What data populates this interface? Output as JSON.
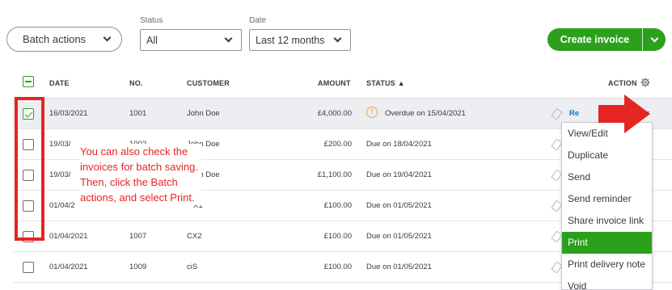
{
  "toolbar": {
    "batch_actions": "Batch actions",
    "status_label": "Status",
    "status_value": "All",
    "date_label": "Date",
    "date_value": "Last 12 months",
    "create_invoice": "Create invoice"
  },
  "table": {
    "headers": {
      "date": "DATE",
      "no": "NO.",
      "customer": "CUSTOMER",
      "amount": "AMOUNT",
      "status": "STATUS ▲",
      "action": "ACTION"
    },
    "rows": [
      {
        "date": "16/03/2021",
        "no": "1001",
        "customer": "John Doe",
        "amount": "£4,000.00",
        "status": "Overdue on 15/04/2021",
        "checked": true,
        "action": "Re"
      },
      {
        "date": "19/03/",
        "no": "1002",
        "customer": "John Doe",
        "amount": "£200.00",
        "status": "Due on 18/04/2021",
        "checked": false
      },
      {
        "date": "19/03/",
        "no": "",
        "customer": "John Doe",
        "amount": "£1,100.00",
        "status": "Due on 19/04/2021",
        "checked": false
      },
      {
        "date": "01/04/2",
        "no": "",
        "customer": "X1",
        "amount": "£100.00",
        "status": "Due on 01/05/2021",
        "checked": false
      },
      {
        "date": "01/04/2021",
        "no": "1007",
        "customer": "CX2",
        "amount": "£100.00",
        "status": "Due on 01/05/2021",
        "checked": false
      },
      {
        "date": "01/04/2021",
        "no": "1009",
        "customer": "ciS",
        "amount": "£100.00",
        "status": "Due on 01/05/2021",
        "checked": false
      }
    ]
  },
  "action_menu": {
    "items": [
      "View/Edit",
      "Duplicate",
      "Send",
      "Send reminder",
      "Share invoice link",
      "Print",
      "Print delivery note",
      "Void"
    ],
    "active": "Print"
  },
  "annotation": {
    "text": "You can also check the invoices for batch saving. Then, click the Batch actions, and select Print.",
    "color": "#e52521"
  },
  "colors": {
    "brand_green": "#2ca01c",
    "link_blue": "#0077c5",
    "warning_orange": "#f2a43a"
  }
}
